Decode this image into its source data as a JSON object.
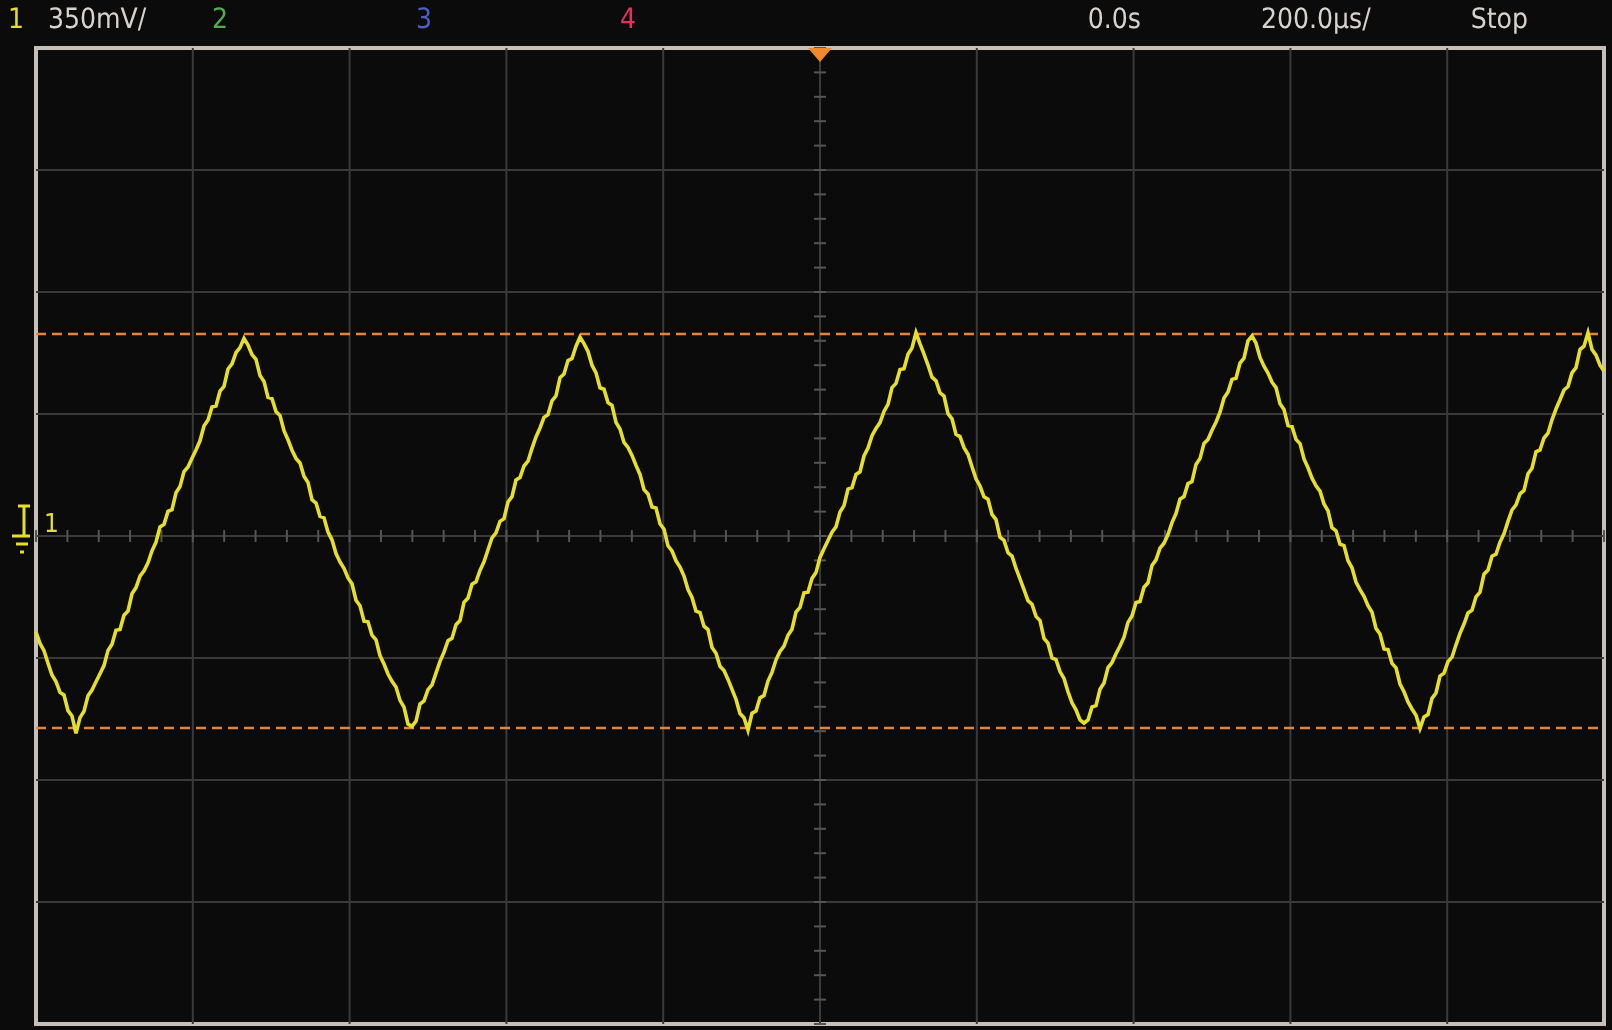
{
  "channels": [
    {
      "label": "1",
      "color": "#e6df2a",
      "scale": "350mV/"
    },
    {
      "label": "2",
      "color": "#4fae4a"
    },
    {
      "label": "3",
      "color": "#4d5fc4"
    },
    {
      "label": "4",
      "color": "#e0325f"
    }
  ],
  "timebase": {
    "delay": "0.0s",
    "scale": "200.0µs/"
  },
  "run_state": "Stop",
  "screen": {
    "channel_marker": "1"
  }
}
